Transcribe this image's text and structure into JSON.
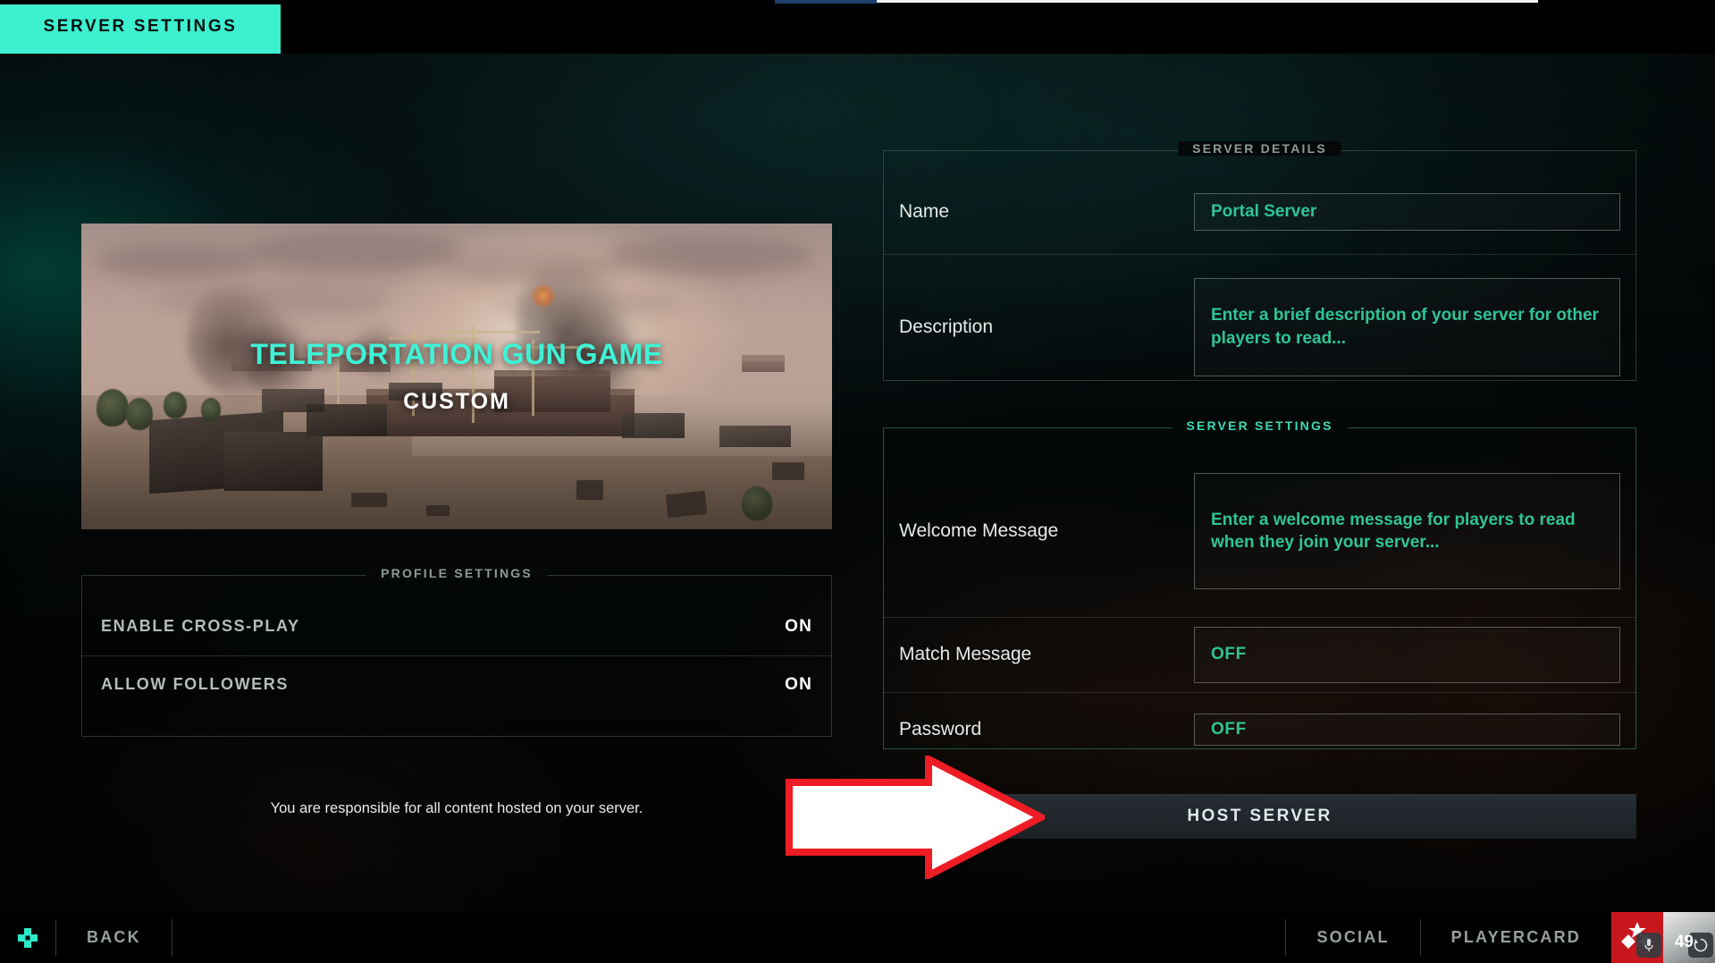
{
  "header": {
    "active_tab_label": "SERVER SETTINGS"
  },
  "top_loader": {
    "blue_segment": "",
    "white_segment": ""
  },
  "map_card": {
    "title": "TELEPORTATION GUN GAME",
    "subtitle": "CUSTOM"
  },
  "profile_settings": {
    "legend": "PROFILE SETTINGS",
    "rows": [
      {
        "label": "ENABLE CROSS-PLAY",
        "value": "ON"
      },
      {
        "label": "ALLOW FOLLOWERS",
        "value": "ON"
      }
    ]
  },
  "disclaimer": "You are responsible for all content hosted on your server.",
  "server_details": {
    "legend": "SERVER DETAILS",
    "name": {
      "label": "Name",
      "value": "Portal Server"
    },
    "description": {
      "label": "Description",
      "placeholder_line1": "Enter a brief description of your server for other",
      "placeholder_line2": "players to read..."
    }
  },
  "server_settings": {
    "legend": "SERVER SETTINGS",
    "welcome_message": {
      "label": "Welcome Message",
      "placeholder_line1": "Enter a welcome message for players to read",
      "placeholder_line2": "when they join your server..."
    },
    "match_message": {
      "label": "Match Message",
      "value": "OFF"
    },
    "password": {
      "label": "Password",
      "value": "OFF"
    }
  },
  "host_button": {
    "label": "HOST SERVER"
  },
  "annotation": {
    "type": "arrow",
    "points_to": "HOST SERVER",
    "fill_color": "#ffffff",
    "outline_color": "#ee1c25"
  },
  "bottom_bar": {
    "dpad_icon": "dpad-icon",
    "back_label": "BACK",
    "social_label": "SOCIAL",
    "playercard_label": "PLAYERCARD",
    "mic_icon": "microphone-icon",
    "sync_icon": "sync-icon",
    "count": "49"
  },
  "colors": {
    "accent_cyan": "#3df0d0",
    "field_green": "#2fc496",
    "title_cyan": "#3ff2d6",
    "annotation_red": "#ee1c25",
    "emblem_red": "#c8161d"
  }
}
